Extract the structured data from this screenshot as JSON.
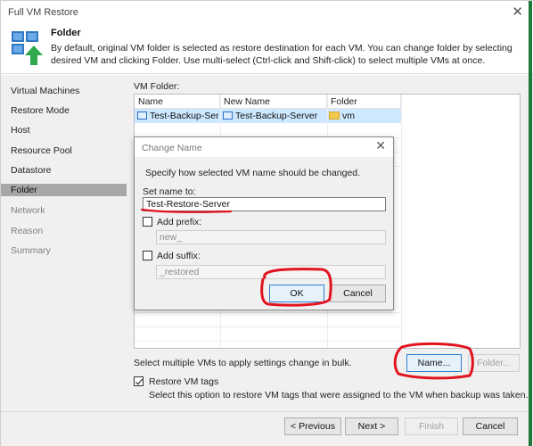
{
  "window": {
    "title": "Full VM Restore",
    "close_glyph": "✕"
  },
  "header": {
    "title": "Folder",
    "description": "By default, original VM folder is selected as restore destination for each VM. You can change folder by selecting desired VM and clicking Folder. Use multi-select (Ctrl-click and Shift-click) to select multiple VMs at once.",
    "icon": "folder-restore-icon"
  },
  "sidebar": {
    "items": [
      {
        "label": "Virtual Machines",
        "state": "normal"
      },
      {
        "label": "Restore Mode",
        "state": "normal"
      },
      {
        "label": "Host",
        "state": "normal"
      },
      {
        "label": "Resource Pool",
        "state": "normal"
      },
      {
        "label": "Datastore",
        "state": "normal"
      },
      {
        "label": "Folder",
        "state": "active"
      },
      {
        "label": "Network",
        "state": "disabled"
      },
      {
        "label": "Reason",
        "state": "disabled"
      },
      {
        "label": "Summary",
        "state": "disabled"
      }
    ]
  },
  "vm_folder": {
    "label": "VM Folder:",
    "columns": [
      "Name",
      "New Name",
      "Folder"
    ],
    "rows": [
      {
        "name": "Test-Backup-Server",
        "new_name": "Test-Backup-Server",
        "folder": "vm",
        "selected": true
      }
    ]
  },
  "bulk": {
    "hint": "Select multiple VMs to apply settings change in bulk.",
    "name_button": "Name...",
    "folder_button": "Folder..."
  },
  "restore_tags": {
    "label": "Restore VM tags",
    "checked": true,
    "description": "Select this option to restore VM tags that were assigned to the VM when backup was taken."
  },
  "footer": {
    "previous": "< Previous",
    "next": "Next >",
    "finish": "Finish",
    "cancel": "Cancel"
  },
  "dialog": {
    "title": "Change Name",
    "close_glyph": "✕",
    "instruction": "Specify how selected VM name should be changed.",
    "set_name_label": "Set name to:",
    "set_name_value": "Test-Restore-Server",
    "add_prefix_label": "Add prefix:",
    "add_prefix_checked": false,
    "prefix_value": "new_",
    "add_suffix_label": "Add suffix:",
    "add_suffix_checked": false,
    "suffix_value": "_restored",
    "ok": "OK",
    "cancel": "Cancel"
  },
  "colors": {
    "accent_green": "#1f7a3a",
    "selection": "#cde8ff",
    "annotation_red": "#e0141e"
  }
}
